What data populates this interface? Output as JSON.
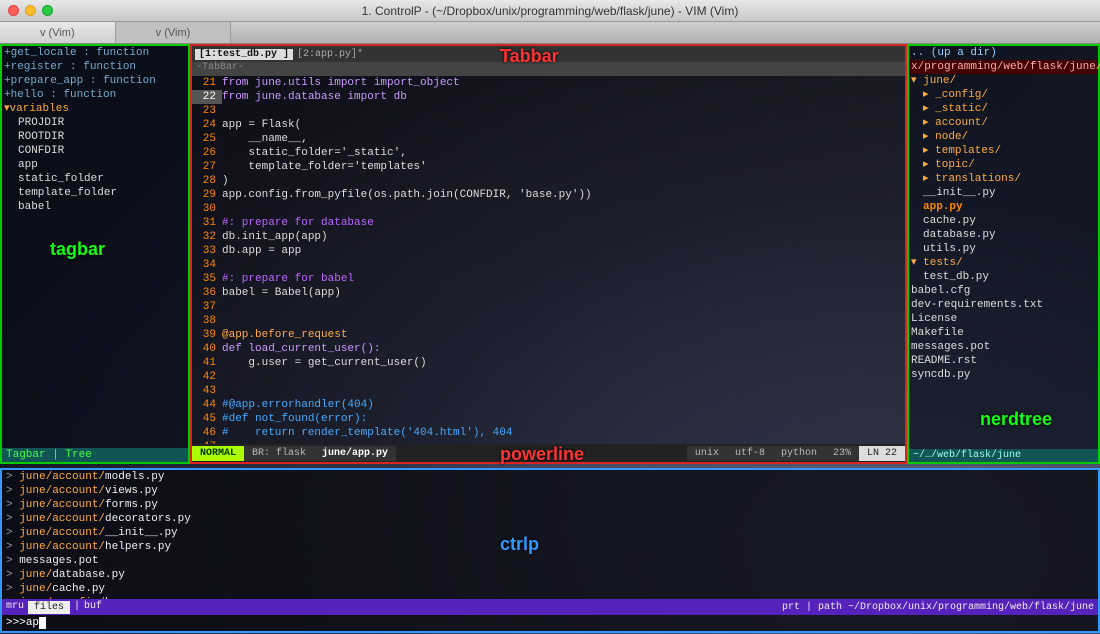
{
  "window": {
    "title": "1. ControlP - (~/Dropbox/unix/programming/web/flask/june) - VIM (Vim)",
    "tabs": [
      "v (Vim)",
      "v (Vim)"
    ]
  },
  "tagbar": {
    "functions": [
      "+get_locale : function",
      "+register : function",
      "+prepare_app : function",
      "+hello : function"
    ],
    "variables_header": "variables",
    "variables": [
      "PROJDIR",
      "ROOTDIR",
      "CONFDIR",
      "app",
      "static_folder",
      "template_folder",
      "babel"
    ],
    "status": "Tagbar | Tree"
  },
  "editor": {
    "tabs": [
      {
        "label": "[1:test_db.py ]",
        "active": true
      },
      {
        "label": "[2:app.py]*",
        "active": false
      }
    ],
    "tabbar_hint": "-TabBar-",
    "lines": [
      {
        "n": 21,
        "t": "from june.utils import import_object",
        "cls": "kw"
      },
      {
        "n": 22,
        "t": "from june.database import db",
        "cls": "kw",
        "cur": true
      },
      {
        "n": 23,
        "t": ""
      },
      {
        "n": 24,
        "t": "app = Flask("
      },
      {
        "n": 25,
        "t": "    __name__,"
      },
      {
        "n": 26,
        "t": "    static_folder='_static',"
      },
      {
        "n": 27,
        "t": "    template_folder='templates'"
      },
      {
        "n": 28,
        "t": ")"
      },
      {
        "n": 29,
        "t": "app.config.from_pyfile(os.path.join(CONFDIR, 'base.py'))"
      },
      {
        "n": 30,
        "t": ""
      },
      {
        "n": 31,
        "t": "#: prepare for database",
        "cls": "pp"
      },
      {
        "n": 32,
        "t": "db.init_app(app)"
      },
      {
        "n": 33,
        "t": "db.app = app"
      },
      {
        "n": 34,
        "t": ""
      },
      {
        "n": 35,
        "t": "#: prepare for babel",
        "cls": "pp"
      },
      {
        "n": 36,
        "t": "babel = Babel(app)"
      },
      {
        "n": 37,
        "t": ""
      },
      {
        "n": 38,
        "t": ""
      },
      {
        "n": 39,
        "t": "@app.before_request",
        "cls": "dec"
      },
      {
        "n": 40,
        "t": "def load_current_user():",
        "cls": "kw"
      },
      {
        "n": 41,
        "t": "    g.user = get_current_user()"
      },
      {
        "n": 42,
        "t": ""
      },
      {
        "n": 43,
        "t": ""
      },
      {
        "n": 44,
        "t": "#@app.errorhandler(404)",
        "cls": "cmhl"
      },
      {
        "n": 45,
        "t": "#def not_found(error):",
        "cls": "cmhl"
      },
      {
        "n": 46,
        "t": "#    return render_template('404.html'), 404",
        "cls": "cmhl"
      },
      {
        "n": 47,
        "t": ""
      }
    ],
    "powerline": {
      "mode": "NORMAL",
      "branch": "BR: flask",
      "file": "june/app.py",
      "format": "unix",
      "enc": "utf-8",
      "ft": "python",
      "pct": "23%",
      "ln": "LN  22"
    }
  },
  "nerdtree": {
    "up": ".. (up a dir)",
    "root": "x/programming/web/flask/june/",
    "tree": [
      {
        "t": "▾ june/",
        "cls": "nt-dir",
        "ind": 0
      },
      {
        "t": "▸ _config/",
        "cls": "nt-dir",
        "ind": 1
      },
      {
        "t": "▸ _static/",
        "cls": "nt-dir",
        "ind": 1
      },
      {
        "t": "▸ account/",
        "cls": "nt-dir",
        "ind": 1
      },
      {
        "t": "▸ node/",
        "cls": "nt-dir",
        "ind": 1
      },
      {
        "t": "▸ templates/",
        "cls": "nt-dir",
        "ind": 1
      },
      {
        "t": "▸ topic/",
        "cls": "nt-dir",
        "ind": 1
      },
      {
        "t": "▸ translations/",
        "cls": "nt-dir",
        "ind": 1
      },
      {
        "t": "__init__.py",
        "cls": "nt-file",
        "ind": 1
      },
      {
        "t": "app.py",
        "cls": "nt-hl",
        "ind": 1
      },
      {
        "t": "cache.py",
        "cls": "nt-file",
        "ind": 1
      },
      {
        "t": "database.py",
        "cls": "nt-file",
        "ind": 1
      },
      {
        "t": "utils.py",
        "cls": "nt-file",
        "ind": 1
      },
      {
        "t": "▾ tests/",
        "cls": "nt-dir",
        "ind": 0
      },
      {
        "t": "test_db.py",
        "cls": "nt-file",
        "ind": 1
      },
      {
        "t": "babel.cfg",
        "cls": "nt-file",
        "ind": 0
      },
      {
        "t": "dev-requirements.txt",
        "cls": "nt-file",
        "ind": 0
      },
      {
        "t": "License",
        "cls": "nt-file",
        "ind": 0
      },
      {
        "t": "Makefile",
        "cls": "nt-file",
        "ind": 0
      },
      {
        "t": "messages.pot",
        "cls": "nt-file",
        "ind": 0
      },
      {
        "t": "README.rst",
        "cls": "nt-file",
        "ind": 0
      },
      {
        "t": "syncdb.py",
        "cls": "nt-file",
        "ind": 0
      }
    ],
    "status": "~/…/web/flask/june"
  },
  "ctrlp": {
    "results": [
      {
        "dir": "june/account/",
        "file": "models.py"
      },
      {
        "dir": "june/account/",
        "file": "views.py"
      },
      {
        "dir": "june/account/",
        "file": "forms.py"
      },
      {
        "dir": "june/account/",
        "file": "decorators.py"
      },
      {
        "dir": "june/account/",
        "file": "__init__.py"
      },
      {
        "dir": "june/account/",
        "file": "helpers.py"
      },
      {
        "dir": "",
        "file": "messages.pot"
      },
      {
        "dir": "june/",
        "file": "database.py"
      },
      {
        "dir": "june/",
        "file": "cache.py"
      },
      {
        "dir": "june/_config/",
        "file": "base.py"
      }
    ],
    "status_left_modes": [
      "mru",
      "files",
      "buf"
    ],
    "status_active_mode": "files",
    "status_right": "prt | path   ~/Dropbox/unix/programming/web/flask/june",
    "prompt_prefix": ">>> ",
    "prompt_value": "ap"
  },
  "overlays": {
    "tabbar": "Tabbar",
    "tagbar": "tagbar",
    "powerline": "powerline",
    "nerdtree": "nerdtree",
    "ctrlp": "ctrlp"
  }
}
